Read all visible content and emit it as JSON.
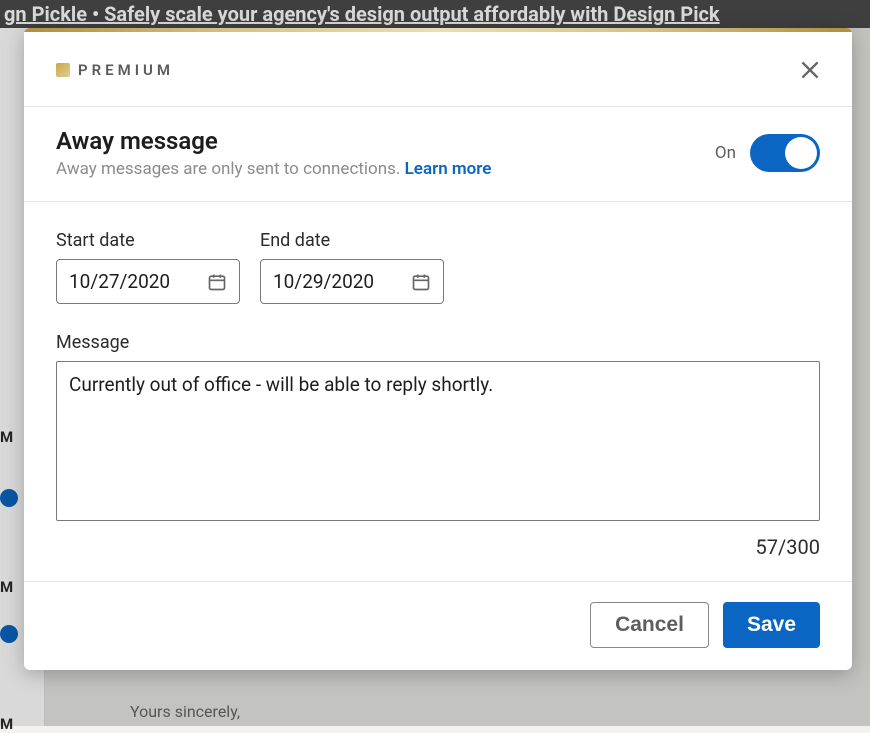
{
  "backdrop": {
    "banner_text": "gn Pickle • Safely scale your agency's design output affordably with Design Pick",
    "letters": [
      "M",
      "M",
      "M"
    ],
    "bottom_text": "Yours sincerely,"
  },
  "header": {
    "premium_label": "PREMIUM"
  },
  "title": {
    "main": "Away message",
    "sub": "Away messages are only sent to connections. ",
    "learn_more": "Learn more"
  },
  "toggle": {
    "state_label": "On",
    "enabled": true
  },
  "dates": {
    "start_label": "Start date",
    "start_value": "10/27/2020",
    "end_label": "End date",
    "end_value": "10/29/2020"
  },
  "message": {
    "label": "Message",
    "value": "Currently out of office - will be able to reply shortly.",
    "char_count": "57/300"
  },
  "actions": {
    "cancel": "Cancel",
    "save": "Save"
  }
}
